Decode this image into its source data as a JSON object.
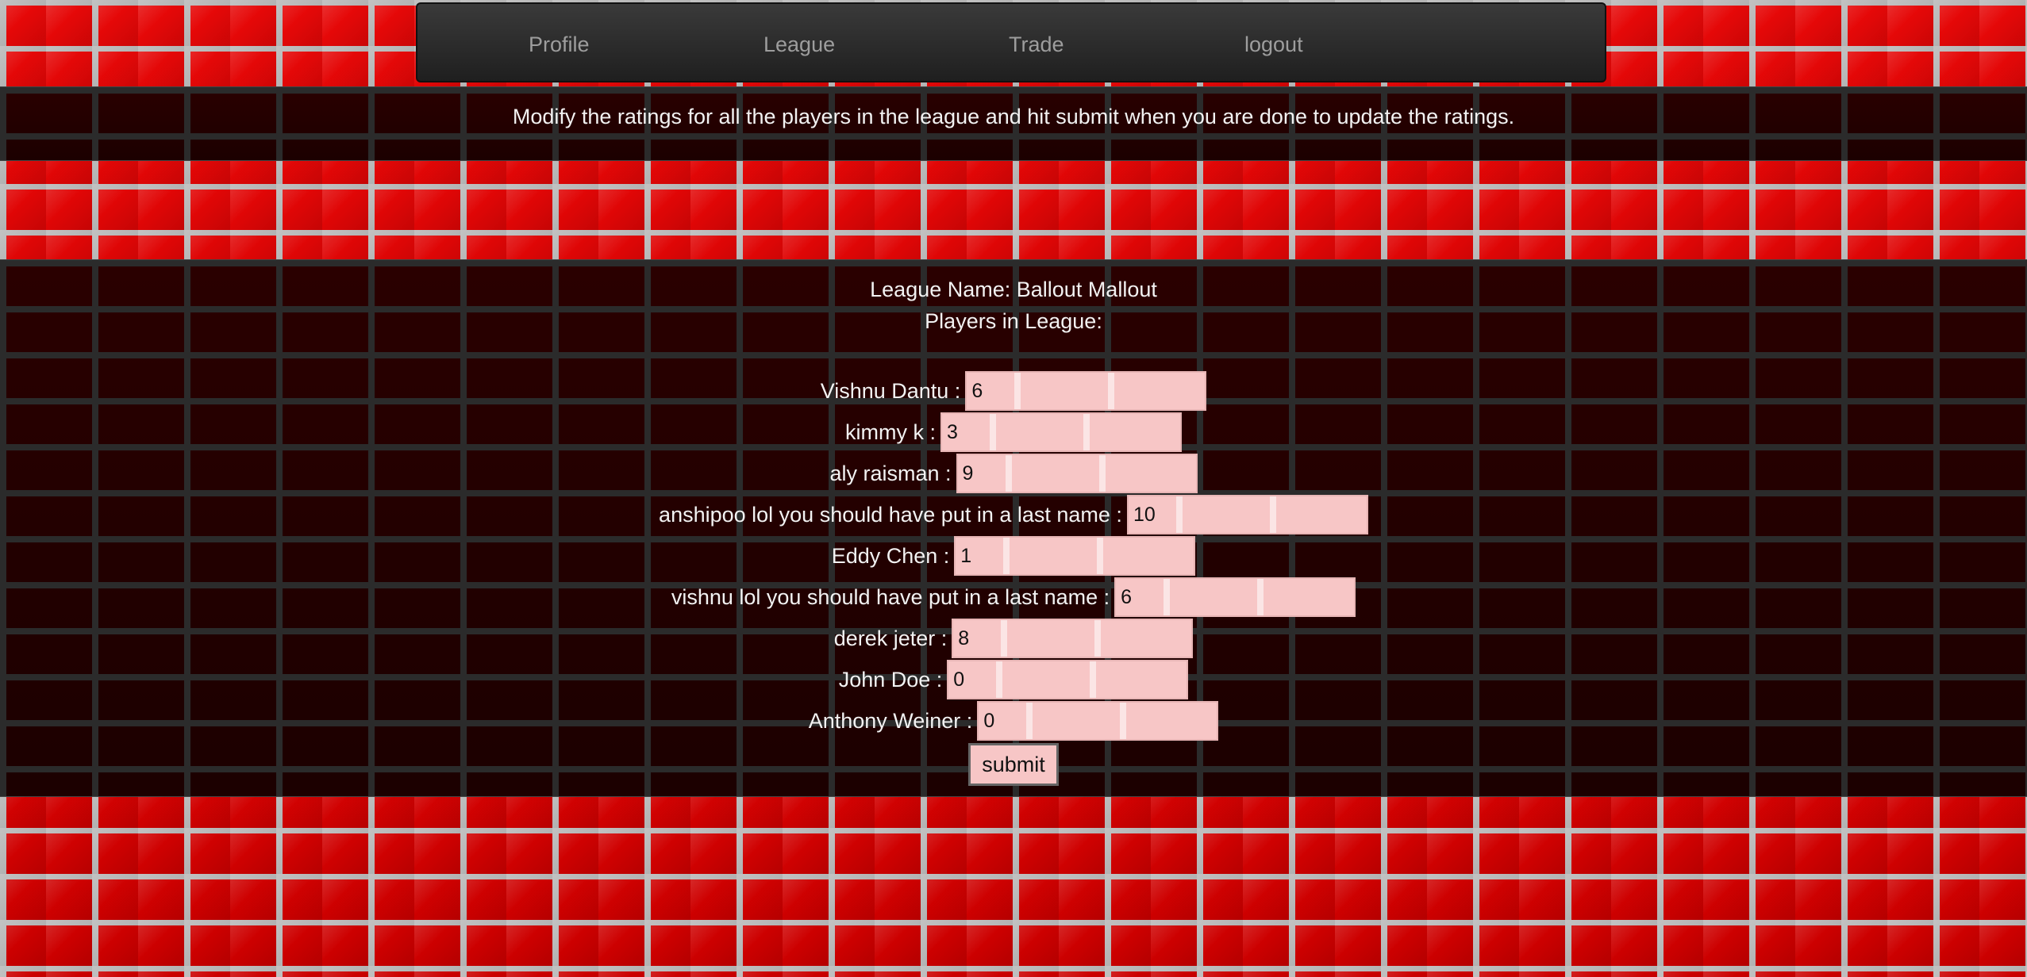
{
  "nav": {
    "items": [
      {
        "label": "Profile"
      },
      {
        "label": "League"
      },
      {
        "label": "Trade"
      },
      {
        "label": "logout"
      }
    ]
  },
  "instruction": "Modify the ratings for all the players in the league and hit submit when you are done to update the ratings.",
  "league": {
    "name_line": "League Name: Ballout Mallout",
    "players_heading": "Players in League:",
    "players": [
      {
        "label": "Vishnu Dantu :",
        "rating": "6"
      },
      {
        "label": "kimmy k :",
        "rating": "3"
      },
      {
        "label": "aly raisman :",
        "rating": "9"
      },
      {
        "label": "anshipoo lol you should have put in a last name :",
        "rating": "10"
      },
      {
        "label": "Eddy Chen :",
        "rating": "1"
      },
      {
        "label": "vishnu lol you should have put in a last name :",
        "rating": "6"
      },
      {
        "label": "derek jeter :",
        "rating": "8"
      },
      {
        "label": "John Doe :",
        "rating": "0"
      },
      {
        "label": "Anthony Weiner :",
        "rating": "0"
      }
    ],
    "submit_label": "submit"
  }
}
